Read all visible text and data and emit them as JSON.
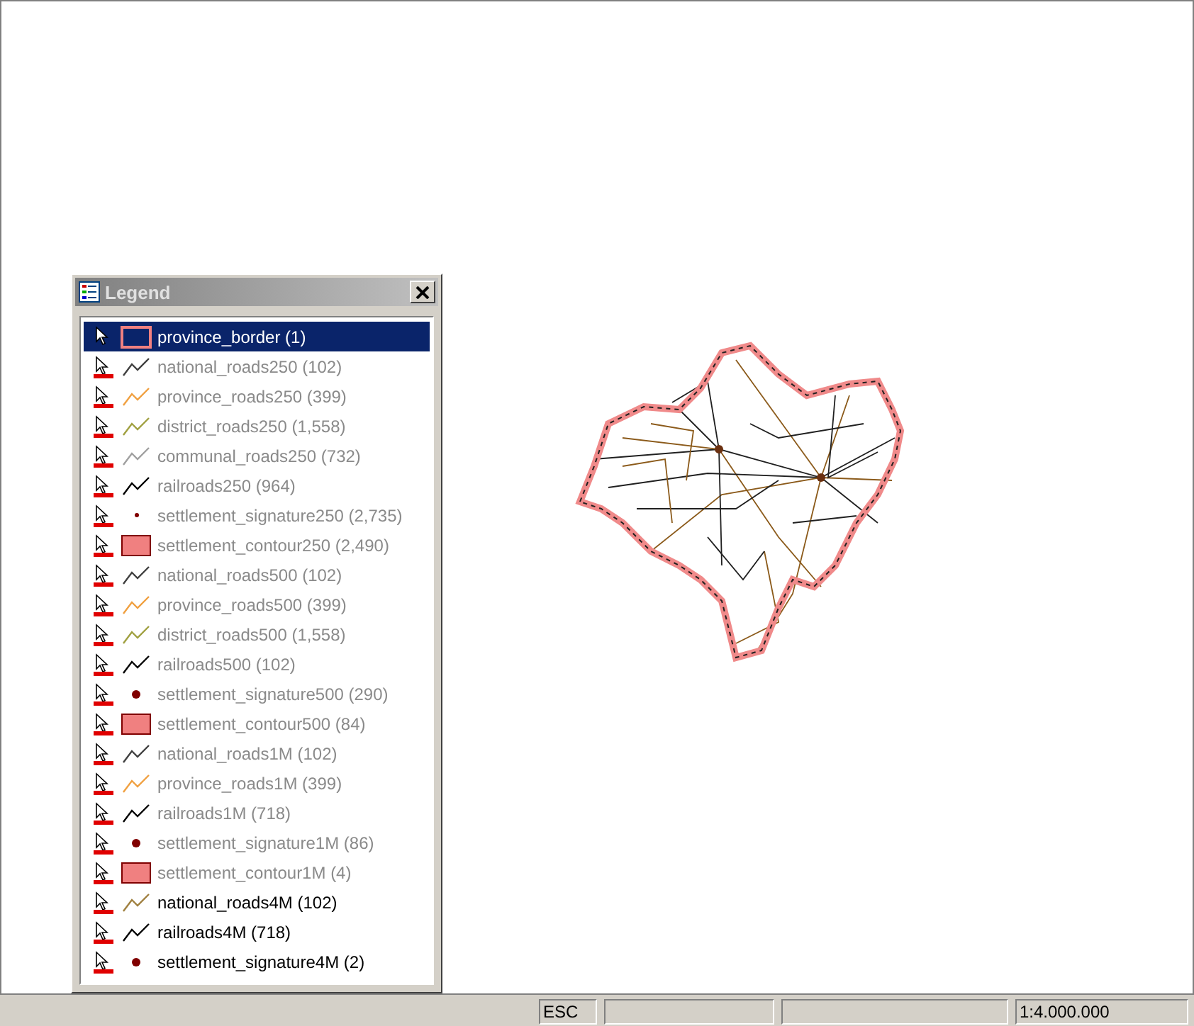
{
  "legend": {
    "title": "Legend",
    "layers": [
      {
        "name": "province_border (1)",
        "kind": "polygon",
        "color": "#f08080",
        "dimmed": false,
        "selected": true
      },
      {
        "name": "national_roads250 (102)",
        "kind": "line",
        "color": "#404040",
        "dimmed": true,
        "selected": false
      },
      {
        "name": "province_roads250 (399)",
        "kind": "line",
        "color": "#f0a040",
        "dimmed": true,
        "selected": false
      },
      {
        "name": "district_roads250 (1,558)",
        "kind": "line",
        "color": "#a0a040",
        "dimmed": true,
        "selected": false
      },
      {
        "name": "communal_roads250 (732)",
        "kind": "line",
        "color": "#a0a0a0",
        "dimmed": true,
        "selected": false
      },
      {
        "name": "railroads250 (964)",
        "kind": "line",
        "color": "#000000",
        "dimmed": true,
        "selected": false
      },
      {
        "name": "settlement_signature250 (2,735)",
        "kind": "point",
        "color": "#800000",
        "dimmed": true,
        "selected": false
      },
      {
        "name": "settlement_contour250 (2,490)",
        "kind": "polygon",
        "color": "#f08080",
        "dimmed": true,
        "selected": false
      },
      {
        "name": "national_roads500 (102)",
        "kind": "line",
        "color": "#404040",
        "dimmed": true,
        "selected": false
      },
      {
        "name": "province_roads500 (399)",
        "kind": "line",
        "color": "#f0a040",
        "dimmed": true,
        "selected": false
      },
      {
        "name": "district_roads500 (1,558)",
        "kind": "line",
        "color": "#a0a040",
        "dimmed": true,
        "selected": false
      },
      {
        "name": "railroads500 (102)",
        "kind": "line",
        "color": "#000000",
        "dimmed": true,
        "selected": false
      },
      {
        "name": "settlement_signature500 (290)",
        "kind": "dot",
        "color": "#800000",
        "dimmed": true,
        "selected": false
      },
      {
        "name": "settlement_contour500 (84)",
        "kind": "polygon",
        "color": "#f08080",
        "dimmed": true,
        "selected": false
      },
      {
        "name": "national_roads1M (102)",
        "kind": "line",
        "color": "#404040",
        "dimmed": true,
        "selected": false
      },
      {
        "name": "province_roads1M (399)",
        "kind": "line",
        "color": "#f0a040",
        "dimmed": true,
        "selected": false
      },
      {
        "name": "railroads1M (718)",
        "kind": "line",
        "color": "#000000",
        "dimmed": true,
        "selected": false
      },
      {
        "name": "settlement_signature1M (86)",
        "kind": "dot",
        "color": "#800000",
        "dimmed": true,
        "selected": false
      },
      {
        "name": "settlement_contour1M (4)",
        "kind": "polygon",
        "color": "#f08080",
        "dimmed": true,
        "selected": false
      },
      {
        "name": "national_roads4M (102)",
        "kind": "line",
        "color": "#a08040",
        "dimmed": false,
        "selected": false
      },
      {
        "name": "railroads4M (718)",
        "kind": "line",
        "color": "#000000",
        "dimmed": false,
        "selected": false
      },
      {
        "name": "settlement_signature4M (2)",
        "kind": "dot",
        "color": "#800000",
        "dimmed": false,
        "selected": false
      }
    ]
  },
  "status_bar": {
    "key": "ESC",
    "scale": "1:4.000.000"
  }
}
